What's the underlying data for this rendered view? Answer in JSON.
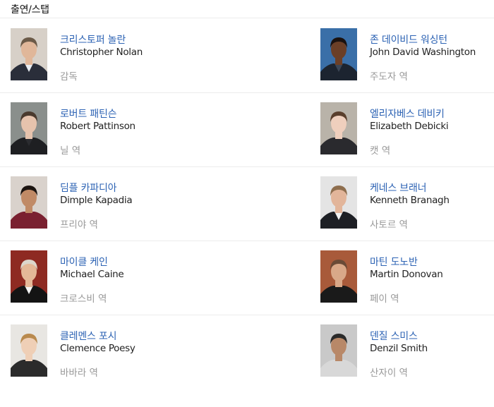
{
  "section": {
    "title": "출연/스탭"
  },
  "cast": [
    {
      "korean_name": "크리스토퍼 놀란",
      "english_name": "Christopher Nolan",
      "role": "감독",
      "photo_icon": "portrait-christopher-nolan",
      "colors": {
        "bg": "#d7d0c8",
        "skin": "#e0b79a",
        "hair": "#6b5a48",
        "cloth": "#2a2e3a",
        "shirt": "#e9edf2"
      }
    },
    {
      "korean_name": "존 데이비드 워싱턴",
      "english_name": "John David Washington",
      "role": "주도자 역",
      "photo_icon": "portrait-john-david-washington",
      "colors": {
        "bg": "#3a6fa8",
        "skin": "#6b3f27",
        "hair": "#1a1210",
        "cloth": "#1c2430",
        "shirt": "#3b4656"
      }
    },
    {
      "korean_name": "로버트 패틴슨",
      "english_name": "Robert Pattinson",
      "role": "닐 역",
      "photo_icon": "portrait-robert-pattinson",
      "colors": {
        "bg": "#8a8f8c",
        "skin": "#e6c3ad",
        "hair": "#4a3a2e",
        "cloth": "#1e1f22",
        "shirt": "#2b2c30"
      }
    },
    {
      "korean_name": "엘리자베스 데비키",
      "english_name": "Elizabeth Debicki",
      "role": "캣 역",
      "photo_icon": "portrait-elizabeth-debicki",
      "colors": {
        "bg": "#b9b3a9",
        "skin": "#efcfbd",
        "hair": "#5a3f2c",
        "cloth": "#2a2a2e",
        "shirt": "#2a2a2e"
      }
    },
    {
      "korean_name": "딤플 카파디아",
      "english_name": "Dimple Kapadia",
      "role": "프리야 역",
      "photo_icon": "portrait-dimple-kapadia",
      "colors": {
        "bg": "#d9d2cc",
        "skin": "#c08a66",
        "hair": "#1b1410",
        "cloth": "#7a2030",
        "shirt": "#7a2030"
      }
    },
    {
      "korean_name": "케네스 브래너",
      "english_name": "Kenneth Branagh",
      "role": "사토르 역",
      "photo_icon": "portrait-kenneth-branagh",
      "colors": {
        "bg": "#e4e4e4",
        "skin": "#e2b59a",
        "hair": "#8e6e4e",
        "cloth": "#1d1f24",
        "shirt": "#f2f2f2"
      }
    },
    {
      "korean_name": "마이클 케인",
      "english_name": "Michael Caine",
      "role": "크로스비 역",
      "photo_icon": "portrait-michael-caine",
      "colors": {
        "bg": "#8e2a22",
        "skin": "#e4b898",
        "hair": "#dcd6cc",
        "cloth": "#141414",
        "shirt": "#f5f5f5"
      }
    },
    {
      "korean_name": "마틴 도노반",
      "english_name": "Martin Donovan",
      "role": "페이 역",
      "photo_icon": "portrait-martin-donovan",
      "colors": {
        "bg": "#a85a3a",
        "skin": "#d9a888",
        "hair": "#6a4a36",
        "cloth": "#1a1a1a",
        "shirt": "#1a1a1a"
      }
    },
    {
      "korean_name": "클레멘스 포시",
      "english_name": "Clemence Poesy",
      "role": "바바라 역",
      "photo_icon": "portrait-clemence-poesy",
      "colors": {
        "bg": "#e8e6e2",
        "skin": "#efcfb6",
        "hair": "#b98a4e",
        "cloth": "#2b2b2b",
        "shirt": "#2b2b2b"
      }
    },
    {
      "korean_name": "덴질 스미스",
      "english_name": "Denzil Smith",
      "role": "산자이 역",
      "photo_icon": "portrait-denzil-smith",
      "colors": {
        "bg": "#c9c9c9",
        "skin": "#b88868",
        "hair": "#2a2a2a",
        "cloth": "#d8d8d8",
        "shirt": "#d8d8d8"
      }
    }
  ]
}
